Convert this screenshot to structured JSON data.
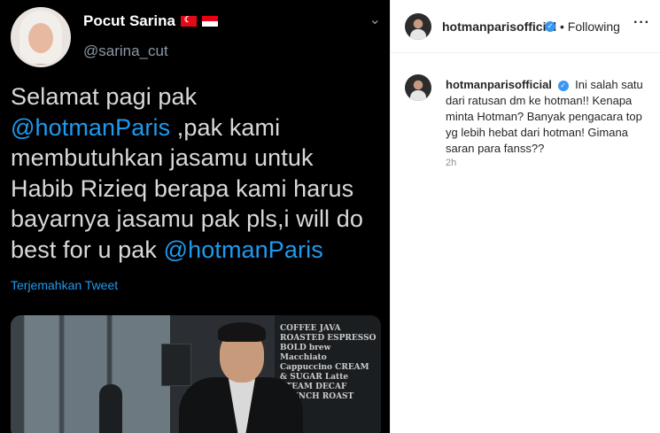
{
  "tweet": {
    "name": "Pocut Sarina",
    "handle": "@sarina_cut",
    "text_parts": [
      "Selamat pagi pak ",
      "@hotmanParis",
      " ,pak kami membutuhkan jasamu untuk Habib Rizieq berapa kami harus bayarnya jasamu pak pls,i will do best for u pak ",
      "@hotmanParis"
    ],
    "translate_label": "Terjemahkan Tweet",
    "photo_board_text": "COFFEE JAVA ROASTED ESPRESSO BOLD brew Macchiato Cappuccino CREAM & SUGAR Latte STEAM DECAF FRENCH ROAST",
    "icons": {
      "options": "chevron-down-icon",
      "flags": [
        "turkey-flag-icon",
        "indonesia-flag-icon"
      ]
    }
  },
  "instagram": {
    "username": "hotmanparisofficial",
    "follow_status": "• Following",
    "more_label": "···",
    "verified_glyph": "✓",
    "caption": "Ini salah satu dari ratusan dm ke hotman!! Kenapa minta Hotman? Banyak pengacara top yg lebih hebat dari hotman! Gimana saran para fanss??",
    "time": "2h",
    "colors": {
      "verified": "#3897f0",
      "text": "#262626",
      "muted": "#8e8e8e"
    }
  },
  "colors": {
    "tweet_background": "#000000",
    "tweet_text": "#d9d9d9",
    "mention": "#1d9bf0",
    "handle": "#8b98a5"
  }
}
